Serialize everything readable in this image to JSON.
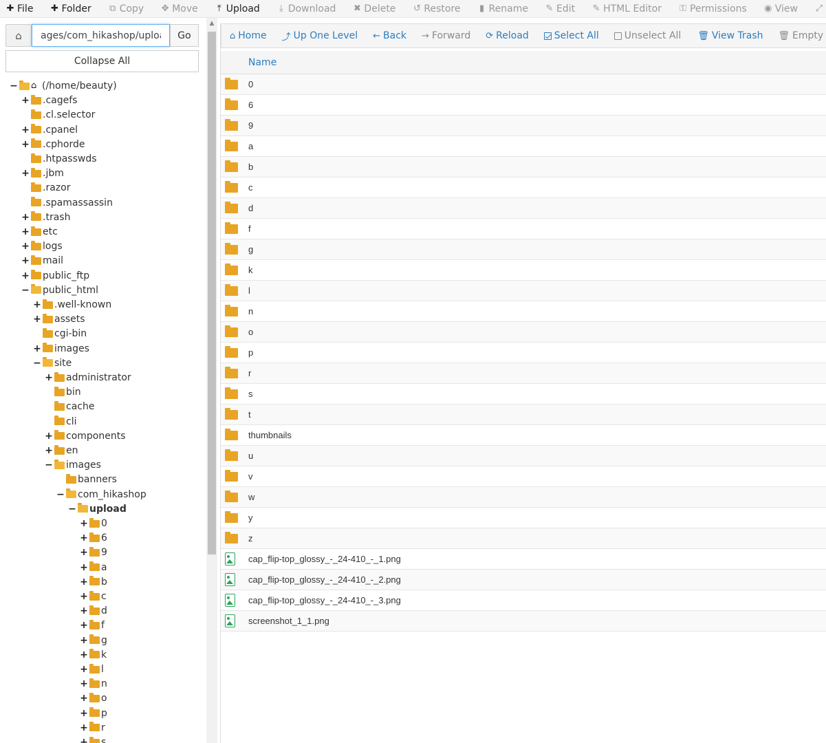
{
  "toolbar": {
    "items": [
      {
        "label": "File",
        "icon": "plus-icon",
        "glyph": "✚",
        "enabled": true
      },
      {
        "label": "Folder",
        "icon": "plus-icon",
        "glyph": "✚",
        "enabled": true
      },
      {
        "label": "Copy",
        "icon": "copy-icon",
        "glyph": "⧉",
        "enabled": false
      },
      {
        "label": "Move",
        "icon": "move-icon",
        "glyph": "✥",
        "enabled": false
      },
      {
        "label": "Upload",
        "icon": "upload-icon",
        "glyph": "⤒",
        "enabled": true
      },
      {
        "label": "Download",
        "icon": "download-icon",
        "glyph": "⤓",
        "enabled": false
      },
      {
        "label": "Delete",
        "icon": "delete-icon",
        "glyph": "✖",
        "enabled": false
      },
      {
        "label": "Restore",
        "icon": "restore-icon",
        "glyph": "↺",
        "enabled": false
      },
      {
        "label": "Rename",
        "icon": "rename-icon",
        "glyph": "▮",
        "enabled": false
      },
      {
        "label": "Edit",
        "icon": "pencil-icon",
        "glyph": "✎",
        "enabled": false
      },
      {
        "label": "HTML Editor",
        "icon": "html-editor-icon",
        "glyph": "✎",
        "enabled": false
      },
      {
        "label": "Permissions",
        "icon": "key-icon",
        "glyph": "⚿",
        "enabled": false
      },
      {
        "label": "View",
        "icon": "eye-icon",
        "glyph": "◉",
        "enabled": false
      },
      {
        "label": "Extra",
        "icon": "expand-icon",
        "glyph": "⤢",
        "enabled": false
      }
    ]
  },
  "path": {
    "value": "ages/com_hikashop/upload",
    "go_label": "Go",
    "collapse_label": "Collapse All"
  },
  "tree": [
    {
      "label": "(/home/beauty)",
      "level": 0,
      "toggle": "−",
      "type": "root"
    },
    {
      "label": ".cagefs",
      "level": 1,
      "toggle": "+",
      "type": "folder"
    },
    {
      "label": ".cl.selector",
      "level": 1,
      "toggle": "",
      "type": "folder"
    },
    {
      "label": ".cpanel",
      "level": 1,
      "toggle": "+",
      "type": "folder"
    },
    {
      "label": ".cphorde",
      "level": 1,
      "toggle": "+",
      "type": "folder"
    },
    {
      "label": ".htpasswds",
      "level": 1,
      "toggle": "",
      "type": "folder"
    },
    {
      "label": ".jbm",
      "level": 1,
      "toggle": "+",
      "type": "folder"
    },
    {
      "label": ".razor",
      "level": 1,
      "toggle": "",
      "type": "folder"
    },
    {
      "label": ".spamassassin",
      "level": 1,
      "toggle": "",
      "type": "folder"
    },
    {
      "label": ".trash",
      "level": 1,
      "toggle": "+",
      "type": "folder"
    },
    {
      "label": "etc",
      "level": 1,
      "toggle": "+",
      "type": "folder"
    },
    {
      "label": "logs",
      "level": 1,
      "toggle": "+",
      "type": "folder"
    },
    {
      "label": "mail",
      "level": 1,
      "toggle": "+",
      "type": "folder"
    },
    {
      "label": "public_ftp",
      "level": 1,
      "toggle": "+",
      "type": "folder"
    },
    {
      "label": "public_html",
      "level": 1,
      "toggle": "−",
      "type": "open"
    },
    {
      "label": ".well-known",
      "level": 2,
      "toggle": "+",
      "type": "folder"
    },
    {
      "label": "assets",
      "level": 2,
      "toggle": "+",
      "type": "folder"
    },
    {
      "label": "cgi-bin",
      "level": 2,
      "toggle": "",
      "type": "folder"
    },
    {
      "label": "images",
      "level": 2,
      "toggle": "+",
      "type": "folder"
    },
    {
      "label": "site",
      "level": 2,
      "toggle": "−",
      "type": "open"
    },
    {
      "label": "administrator",
      "level": 3,
      "toggle": "+",
      "type": "folder"
    },
    {
      "label": "bin",
      "level": 3,
      "toggle": "",
      "type": "folder"
    },
    {
      "label": "cache",
      "level": 3,
      "toggle": "",
      "type": "folder"
    },
    {
      "label": "cli",
      "level": 3,
      "toggle": "",
      "type": "folder"
    },
    {
      "label": "components",
      "level": 3,
      "toggle": "+",
      "type": "folder"
    },
    {
      "label": "en",
      "level": 3,
      "toggle": "+",
      "type": "folder"
    },
    {
      "label": "images",
      "level": 3,
      "toggle": "−",
      "type": "open"
    },
    {
      "label": "banners",
      "level": 4,
      "toggle": "",
      "type": "folder"
    },
    {
      "label": "com_hikashop",
      "level": 4,
      "toggle": "−",
      "type": "open"
    },
    {
      "label": "upload",
      "level": 5,
      "toggle": "−",
      "type": "open",
      "bold": true
    },
    {
      "label": "0",
      "level": 6,
      "toggle": "+",
      "type": "folder"
    },
    {
      "label": "6",
      "level": 6,
      "toggle": "+",
      "type": "folder"
    },
    {
      "label": "9",
      "level": 6,
      "toggle": "+",
      "type": "folder"
    },
    {
      "label": "a",
      "level": 6,
      "toggle": "+",
      "type": "folder"
    },
    {
      "label": "b",
      "level": 6,
      "toggle": "+",
      "type": "folder"
    },
    {
      "label": "c",
      "level": 6,
      "toggle": "+",
      "type": "folder"
    },
    {
      "label": "d",
      "level": 6,
      "toggle": "+",
      "type": "folder"
    },
    {
      "label": "f",
      "level": 6,
      "toggle": "+",
      "type": "folder"
    },
    {
      "label": "g",
      "level": 6,
      "toggle": "+",
      "type": "folder"
    },
    {
      "label": "k",
      "level": 6,
      "toggle": "+",
      "type": "folder"
    },
    {
      "label": "l",
      "level": 6,
      "toggle": "+",
      "type": "folder"
    },
    {
      "label": "n",
      "level": 6,
      "toggle": "+",
      "type": "folder"
    },
    {
      "label": "o",
      "level": 6,
      "toggle": "+",
      "type": "folder"
    },
    {
      "label": "p",
      "level": 6,
      "toggle": "+",
      "type": "folder"
    },
    {
      "label": "r",
      "level": 6,
      "toggle": "+",
      "type": "folder"
    },
    {
      "label": "s",
      "level": 6,
      "toggle": "+",
      "type": "folder"
    }
  ],
  "actions": [
    {
      "label": "Home",
      "icon": "home-icon",
      "glyph": "⌂",
      "enabled": true
    },
    {
      "label": "Up One Level",
      "icon": "level-up-icon",
      "glyph": "⤴",
      "enabled": true
    },
    {
      "label": "Back",
      "icon": "back-arrow-icon",
      "glyph": "←",
      "enabled": true
    },
    {
      "label": "Forward",
      "icon": "forward-arrow-icon",
      "glyph": "→",
      "enabled": false
    },
    {
      "label": "Reload",
      "icon": "reload-icon",
      "glyph": "⟳",
      "enabled": true
    },
    {
      "label": "Select All",
      "icon": "checkbox-checked-icon",
      "glyph": "check",
      "enabled": true
    },
    {
      "label": "Unselect All",
      "icon": "checkbox-empty-icon",
      "glyph": "box",
      "enabled": false
    },
    {
      "label": "View Trash",
      "icon": "trash-icon",
      "glyph": "🗑",
      "enabled": true,
      "sep_before": true
    },
    {
      "label": "Empty Trash",
      "icon": "trash-icon",
      "glyph": "🗑",
      "enabled": false
    }
  ],
  "table": {
    "column_name": "Name",
    "rows": [
      {
        "name": "0",
        "type": "folder"
      },
      {
        "name": "6",
        "type": "folder"
      },
      {
        "name": "9",
        "type": "folder"
      },
      {
        "name": "a",
        "type": "folder"
      },
      {
        "name": "b",
        "type": "folder"
      },
      {
        "name": "c",
        "type": "folder"
      },
      {
        "name": "d",
        "type": "folder"
      },
      {
        "name": "f",
        "type": "folder"
      },
      {
        "name": "g",
        "type": "folder"
      },
      {
        "name": "k",
        "type": "folder"
      },
      {
        "name": "l",
        "type": "folder"
      },
      {
        "name": "n",
        "type": "folder"
      },
      {
        "name": "o",
        "type": "folder"
      },
      {
        "name": "p",
        "type": "folder"
      },
      {
        "name": "r",
        "type": "folder"
      },
      {
        "name": "s",
        "type": "folder"
      },
      {
        "name": "t",
        "type": "folder"
      },
      {
        "name": "thumbnails",
        "type": "folder"
      },
      {
        "name": "u",
        "type": "folder"
      },
      {
        "name": "v",
        "type": "folder"
      },
      {
        "name": "w",
        "type": "folder"
      },
      {
        "name": "y",
        "type": "folder"
      },
      {
        "name": "z",
        "type": "folder"
      },
      {
        "name": "cap_flip-top_glossy_-_24-410_-_1.png",
        "type": "image"
      },
      {
        "name": "cap_flip-top_glossy_-_24-410_-_2.png",
        "type": "image"
      },
      {
        "name": "cap_flip-top_glossy_-_24-410_-_3.png",
        "type": "image"
      },
      {
        "name": "screenshot_1_1.png",
        "type": "image"
      }
    ]
  },
  "colors": {
    "accent": "#2b7dbf",
    "folder": "#e8a424",
    "image_file": "#2aa65a"
  }
}
